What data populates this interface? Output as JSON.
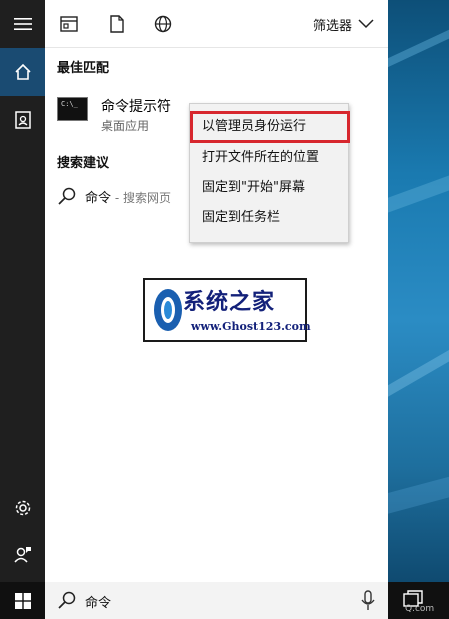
{
  "toolbar": {
    "filter_label": "筛选器"
  },
  "sections": {
    "best_match": "最佳匹配",
    "search_suggestions": "搜索建议"
  },
  "best_match": {
    "name": "命令提示符",
    "subtitle": "桌面应用",
    "icon_text": "C:\\_"
  },
  "suggestion": {
    "query": "命令",
    "subtitle": " - 搜索网页"
  },
  "context_menu": {
    "items": [
      "以管理员身份运行",
      "打开文件所在的位置",
      "固定到\"开始\"屏幕",
      "固定到任务栏"
    ]
  },
  "logo": {
    "title": "系统之家",
    "url": "www.Ghost123.com"
  },
  "taskbar": {
    "search_query": "命令",
    "tray_text": "Q.com"
  },
  "colors": {
    "rail": "#1f1f1f",
    "rail_active": "#1a4b72",
    "highlight_border": "#d7272e",
    "logo_text": "#13217a"
  }
}
